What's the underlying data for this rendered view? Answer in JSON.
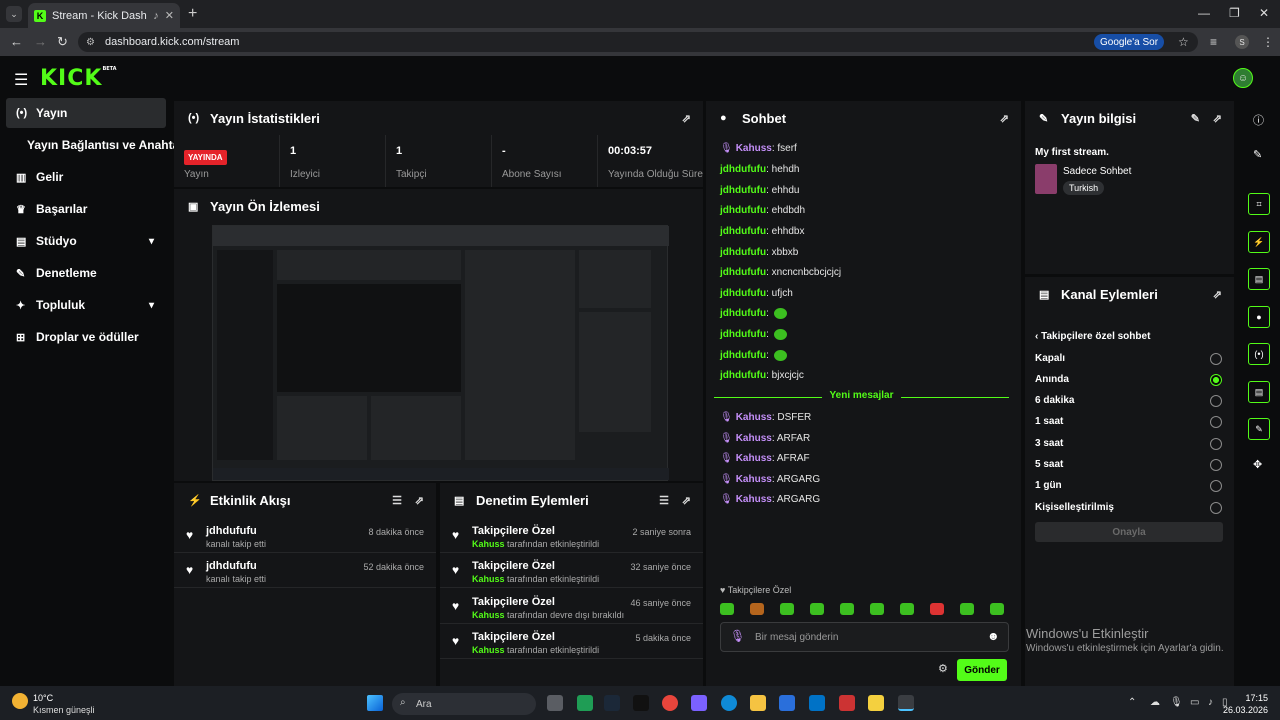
{
  "browser": {
    "tab_title": "Stream - Kick Dashboard",
    "url": "dashboard.kick.com/stream",
    "google_sor": "Google'a Sor",
    "profile_initial": "S"
  },
  "kick": {
    "logo": "KICK",
    "beta": "BETA"
  },
  "sidebar": {
    "items": [
      {
        "label": "Yayın",
        "icon": "broadcast-icon"
      },
      {
        "label": "Yayın Bağlantısı ve Anahtarı"
      },
      {
        "label": "Gelir",
        "icon": "chart-icon"
      },
      {
        "label": "Başarılar",
        "icon": "trophy-icon"
      },
      {
        "label": "Stüdyo",
        "icon": "studio-icon"
      },
      {
        "label": "Denetleme",
        "icon": "wrench-icon"
      },
      {
        "label": "Topluluk",
        "icon": "community-icon"
      },
      {
        "label": "Droplar ve ödüller",
        "icon": "drops-icon"
      }
    ]
  },
  "stats_panel": {
    "title": "Yayın İstatistikleri",
    "live_badge": "YAYINDA",
    "live_label": "Yayın",
    "stats": [
      {
        "value": "1",
        "label": "İzleyici"
      },
      {
        "value": "1",
        "label": "Takipçi"
      },
      {
        "value": "-",
        "label": "Abone Sayısı"
      },
      {
        "value": "00:03:57",
        "label": "Yayında Olduğu Süre"
      }
    ]
  },
  "preview_panel": {
    "title": "Yayın Ön İzlemesi"
  },
  "activity_panel": {
    "title": "Etkinlik Akışı",
    "items": [
      {
        "user": "jdhdufufu",
        "sub": "kanalı takip etti",
        "time": "8 dakika önce"
      },
      {
        "user": "jdhdufufu",
        "sub": "kanalı takip etti",
        "time": "52 dakika önce"
      }
    ]
  },
  "moderation_panel": {
    "title": "Denetim Eylemleri",
    "items": [
      {
        "title": "Takipçilere Özel",
        "user": "Kahuss",
        "sub": "tarafından etkinleştirildi",
        "time": "2 saniye sonra"
      },
      {
        "title": "Takipçilere Özel",
        "user": "Kahuss",
        "sub": "tarafından etkinleştirildi",
        "time": "32 saniye önce"
      },
      {
        "title": "Takipçilere Özel",
        "user": "Kahuss",
        "sub": "tarafından devre dışı bırakıldı",
        "time": "46 saniye önce"
      },
      {
        "title": "Takipçilere Özel",
        "user": "Kahuss",
        "sub": "tarafından etkinleştirildi",
        "time": "5 dakika önce"
      }
    ]
  },
  "chat_panel": {
    "title": "Sohbet",
    "messages": [
      {
        "user": "Kahuss",
        "text": "fserf",
        "mod": true
      },
      {
        "user": "jdhdufufu",
        "text": "hehdh"
      },
      {
        "user": "jdhdufufu",
        "text": "ehhdu"
      },
      {
        "user": "jdhdufufu",
        "text": "ehdbdh"
      },
      {
        "user": "jdhdufufu",
        "text": "ehhdbx"
      },
      {
        "user": "jdhdufufu",
        "text": "xbbxb"
      },
      {
        "user": "jdhdufufu",
        "text": "xncncnbcbcjcjcj"
      },
      {
        "user": "jdhdufufu",
        "text": "ufjch"
      },
      {
        "user": "jdhdufufu",
        "text": ""
      },
      {
        "user": "jdhdufufu",
        "text": ""
      },
      {
        "user": "jdhdufufu",
        "text": ""
      },
      {
        "user": "jdhdufufu",
        "text": "bjxcjcjc"
      }
    ],
    "new_messages_label": "Yeni mesajlar",
    "new_messages": [
      {
        "user": "Kahuss",
        "text": "DSFER"
      },
      {
        "user": "Kahuss",
        "text": "ARFAR"
      },
      {
        "user": "Kahuss",
        "text": "AFRAF"
      },
      {
        "user": "Kahuss",
        "text": "ARGARG"
      },
      {
        "user": "Kahuss",
        "text": "ARGARG"
      }
    ],
    "mode_label": "Takipçilere Özel",
    "input_placeholder": "Bir mesaj gönderin",
    "send_label": "Gönder"
  },
  "info_panel": {
    "title": "Yayın bilgisi",
    "stream_title": "My first stream.",
    "category": "Sadece Sohbet",
    "language": "Turkish"
  },
  "channel_actions": {
    "title": "Kanal Eylemleri",
    "back_label": "Takipçilere özel sohbet",
    "options": [
      {
        "label": "Kapalı",
        "selected": false
      },
      {
        "label": "Anında",
        "selected": true
      },
      {
        "label": "6 dakika",
        "selected": false
      },
      {
        "label": "1 saat",
        "selected": false
      },
      {
        "label": "3 saat",
        "selected": false
      },
      {
        "label": "5 saat",
        "selected": false
      },
      {
        "label": "1 gün",
        "selected": false
      },
      {
        "label": "Kişiselleştirilmiş",
        "selected": false
      }
    ],
    "confirm_label": "Onayla"
  },
  "watermark": {
    "title": "Windows'u Etkinleştir",
    "sub": "Windows'u etkinleştirmek için Ayarlar'a gidin."
  },
  "taskbar": {
    "weather_temp": "10°C",
    "weather_desc": "Kısmen güneşli",
    "search": "Ara",
    "time": "17:15",
    "date": "26.03.2026"
  },
  "colors": {
    "accent": "#53fc18",
    "live": "#e5232a",
    "mod": "#c48ff8"
  }
}
